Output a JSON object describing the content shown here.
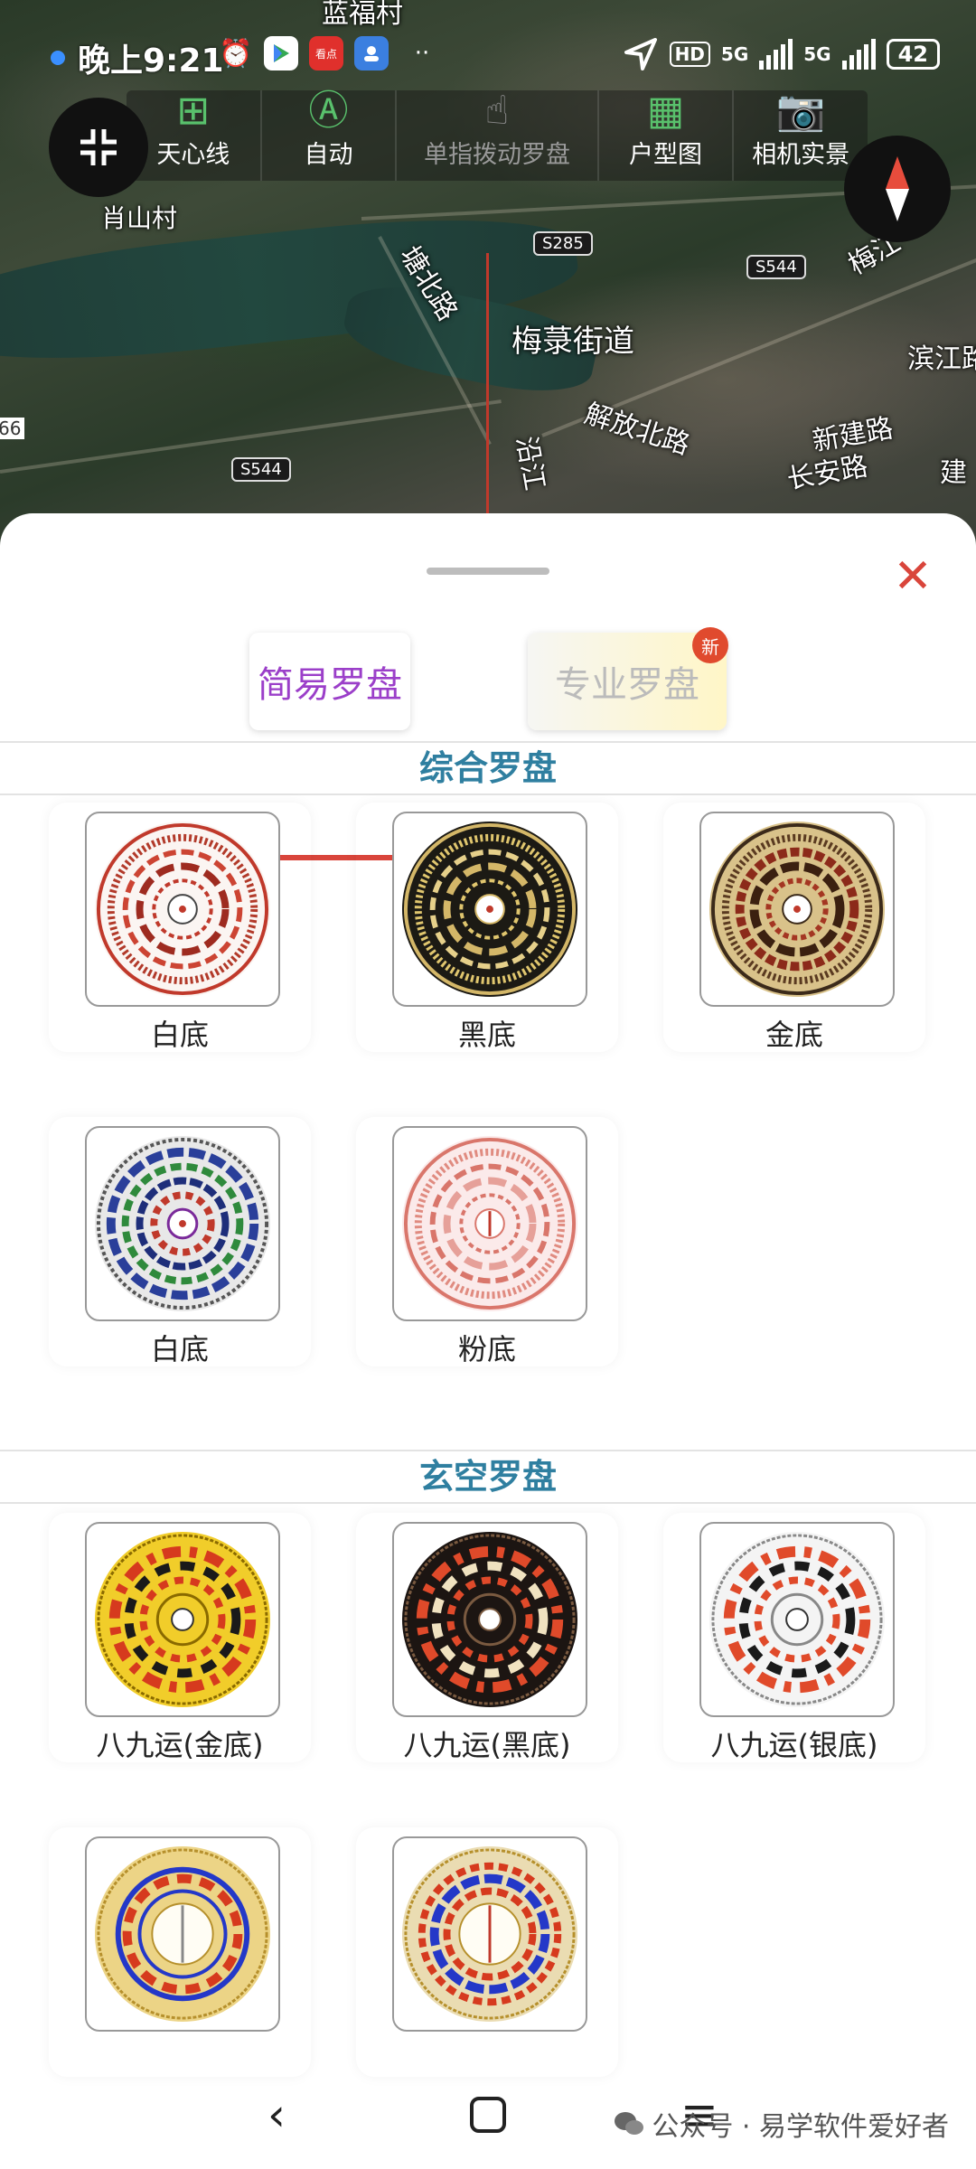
{
  "status_bar": {
    "time": "晚上9:21",
    "network": "5G",
    "network2": "5G",
    "hd": "HD",
    "battery": "42"
  },
  "toolbar": {
    "items": [
      {
        "label": "天心线",
        "icon": "grid-icon"
      },
      {
        "label": "自动",
        "icon": "auto-icon"
      },
      {
        "label": "单指拨动罗盘",
        "icon": "hand-icon"
      },
      {
        "label": "户型图",
        "icon": "building-icon"
      },
      {
        "label": "相机实景",
        "icon": "camera-icon"
      }
    ]
  },
  "map": {
    "labels": [
      "蓝福村",
      "肖山村",
      "梅菉街道",
      "解放北路",
      "新建路",
      "长安路",
      "滨江路",
      "沿江",
      "梅江",
      "建",
      "塘北路",
      "66"
    ],
    "shields": [
      "S285",
      "S544",
      "S544"
    ]
  },
  "sheet": {
    "tabs": {
      "simple": "简易罗盘",
      "pro": "专业罗盘",
      "badge": "新"
    },
    "sections": [
      {
        "title": "综合罗盘",
        "items": [
          "白底",
          "黑底",
          "金底",
          "白底",
          "粉底"
        ]
      },
      {
        "title": "玄空罗盘",
        "items": [
          "八九运(金底)",
          "八九运(黑底)",
          "八九运(银底)",
          "",
          ""
        ]
      }
    ]
  },
  "watermark": {
    "text": "公众号 · 易学软件爱好者"
  },
  "colors": {
    "accent": "#d9453b",
    "tab_active": "#9b3fc9",
    "section_title": "#2f7fa0",
    "toolbar_icon": "#59c16c"
  }
}
